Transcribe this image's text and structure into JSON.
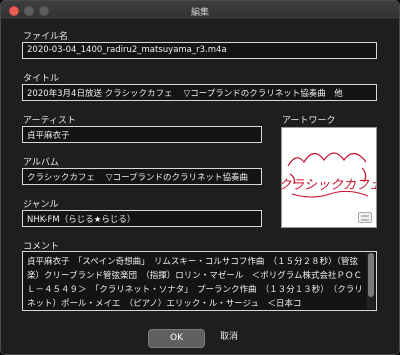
{
  "window": {
    "title": "編集"
  },
  "fields": {
    "filename": {
      "label": "ファイル名",
      "value": "2020-03-04_1400_radiru2_matsuyama_r3.m4a"
    },
    "title": {
      "label": "タイトル",
      "value": "2020年3月4日放送 クラシックカフェ　 ▽コープランドのクラリネット協奏曲　他"
    },
    "artist": {
      "label": "アーティスト",
      "value": "貞平麻衣子"
    },
    "album": {
      "label": "アルバム",
      "value": "クラシックカフェ　 ▽コープランドのクラリネット協奏曲"
    },
    "genre": {
      "label": "ジャンル",
      "value": "NHK-FM（らじる★らじる）"
    },
    "artwork": {
      "label": "アートワーク",
      "text": "クラシックカフェ"
    },
    "comment": {
      "label": "コメント",
      "value": "貞平麻衣子　「スペイン奇想曲」　リムスキー・コルサコフ作曲　（１５分２８秒）（管弦楽）クリーブランド管弦楽団　（指揮）ロリン・マゼール　＜ポリグラム株式会社ＰＯＣＬ－４５４９＞　「クラリネット・ソナタ」　プーランク作曲　（１３分１３秒）　（クラリネット）ポール・メイエ　（ピアノ）エリック・ル・サージュ　＜日本コ"
    }
  },
  "buttons": {
    "ok": "OK",
    "cancel": "取消"
  },
  "colors": {
    "close": "#ee5f57",
    "artwork_text": "#c8102e",
    "artwork_bg": "#ffffff"
  }
}
